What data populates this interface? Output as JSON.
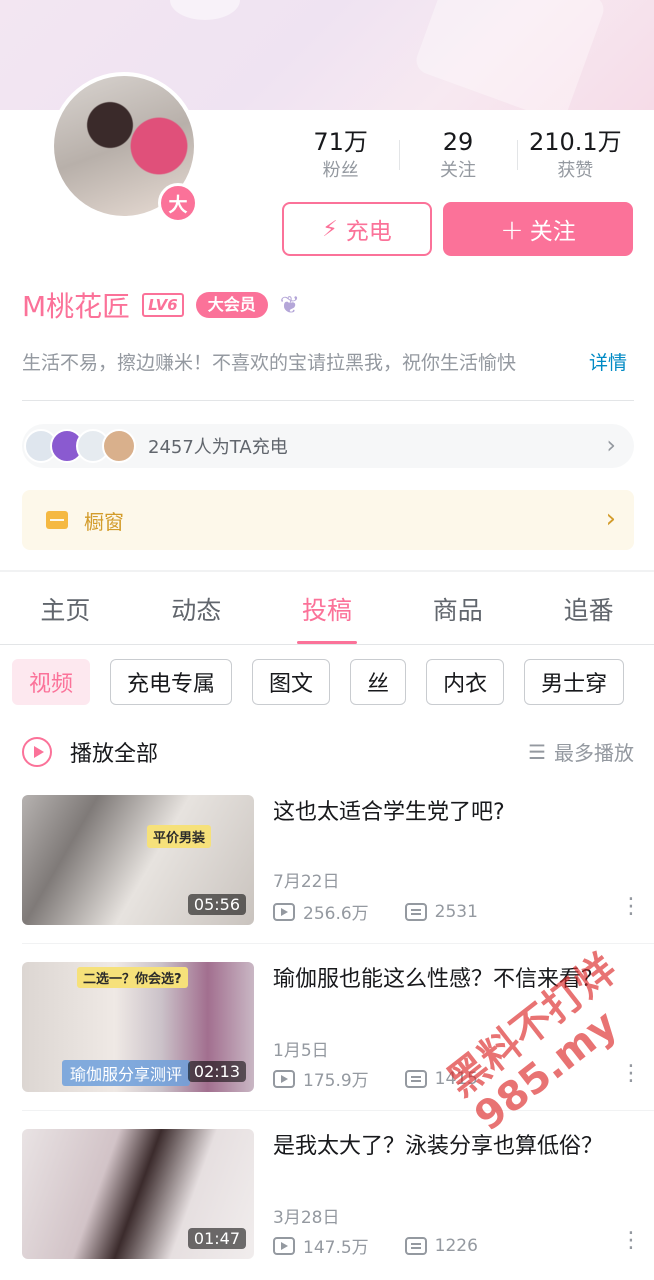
{
  "profile": {
    "avatar_badge": "大",
    "stats": [
      {
        "num": "71万",
        "label": "粉丝"
      },
      {
        "num": "29",
        "label": "关注"
      },
      {
        "num": "210.1万",
        "label": "获赞"
      }
    ],
    "charge_button": "充电",
    "follow_button": "关注",
    "username": "M桃花匠",
    "level": "LV6",
    "vip_tag": "大会员",
    "bio": "生活不易，擦边赚米！不喜欢的宝请拉黑我，祝你生活愉快",
    "bio_detail": "详情",
    "charge_count_text": "2457人为TA充电",
    "shop_text": "橱窗"
  },
  "colors": {
    "accent": "#fb7299",
    "shop": "#d39c2b"
  },
  "tabs": [
    "主页",
    "动态",
    "投稿",
    "商品",
    "追番"
  ],
  "active_tab": "投稿",
  "chips": [
    "视频",
    "充电专属",
    "图文",
    "丝",
    "内衣",
    "男士穿"
  ],
  "play_all": "播放全部",
  "sort_label": "最多播放",
  "videos": [
    {
      "title": "这也太适合学生党了吧?",
      "date": "7月22日",
      "plays": "256.6万",
      "danmaku": "2531",
      "duration": "05:56",
      "thumb_text": "平价男装"
    },
    {
      "title": "瑜伽服也能这么性感？不信来看？",
      "date": "1月5日",
      "plays": "175.9万",
      "danmaku": "1415",
      "duration": "02:13",
      "thumb_text": "二选一？你会选?",
      "thumb_sub": "瑜伽服分享测评"
    },
    {
      "title": "是我太大了？泳装分享也算低俗？",
      "date": "3月28日",
      "plays": "147.5万",
      "danmaku": "1226",
      "duration": "01:47"
    }
  ],
  "watermark": [
    "黑料不打烊",
    "985.my"
  ]
}
